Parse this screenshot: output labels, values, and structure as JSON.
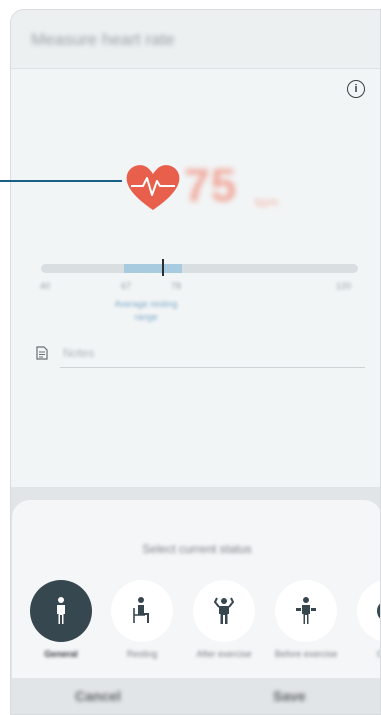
{
  "header": {
    "title": "Measure heart rate"
  },
  "measurement": {
    "value": "75",
    "unit": "bpm"
  },
  "range": {
    "ticks": [
      "40",
      "67",
      "78",
      "120"
    ],
    "average_label": "Average resting range",
    "marker_value": 75,
    "range_min": 40,
    "range_max": 120,
    "average_low": 67,
    "average_high": 78
  },
  "notes": {
    "placeholder": "Notes"
  },
  "status_sheet": {
    "title": "Select current status",
    "options": [
      {
        "label": "General",
        "selected": true
      },
      {
        "label": "Resting",
        "selected": false
      },
      {
        "label": "After exercise",
        "selected": false
      },
      {
        "label": "Before exercise",
        "selected": false
      },
      {
        "label": "Other",
        "selected": false
      }
    ]
  },
  "actions": {
    "cancel_label": "Cancel",
    "save_label": "Save"
  },
  "colors": {
    "heart": "#e8604c",
    "average_range": "#a8cbe0",
    "selected_option": "#37474f",
    "callout": "#1a5f86"
  },
  "icons": {
    "info": "info-icon",
    "heart": "heart-pulse-icon",
    "note": "note-icon",
    "options": [
      "person-standing-icon",
      "person-sitting-icon",
      "person-flexing-icon",
      "person-weights-icon",
      "more-icon"
    ]
  }
}
